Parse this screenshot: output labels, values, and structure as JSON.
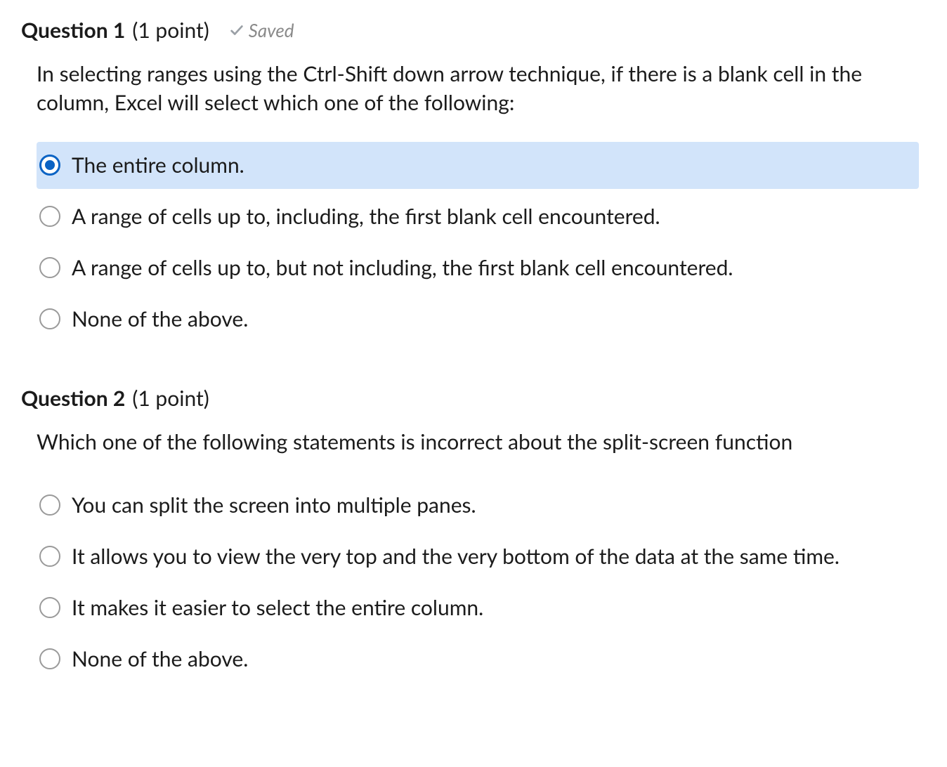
{
  "questions": [
    {
      "number_label": "Question 1",
      "points_label": "(1 point)",
      "saved_label": "Saved",
      "show_saved": true,
      "prompt": "In selecting ranges using the Ctrl-Shift down arrow technique, if there is a blank cell in the column, Excel will select which one of the following:",
      "selected_index": 0,
      "options": [
        "The entire column.",
        "A range of cells up to, including, the first blank cell encountered.",
        "A range of cells up to, but not including, the first blank cell encountered.",
        "None of the above."
      ]
    },
    {
      "number_label": "Question 2",
      "points_label": "(1 point)",
      "saved_label": "",
      "show_saved": false,
      "prompt": "Which one of the following statements is incorrect about the split-screen function",
      "selected_index": -1,
      "options": [
        "You can split the screen into multiple panes.",
        "It allows you to view the very top and the very bottom of the data at the same time.",
        "It makes it easier to select the entire column.",
        "None of the above."
      ]
    }
  ]
}
